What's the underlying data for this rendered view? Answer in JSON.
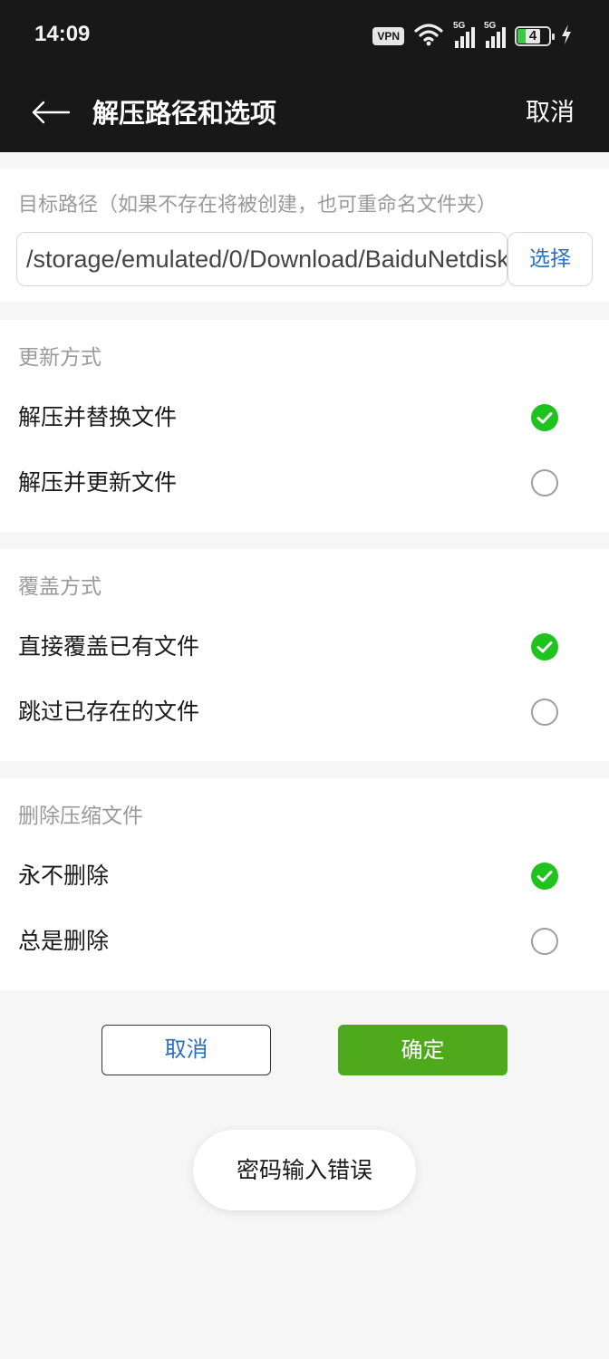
{
  "status_bar": {
    "time": "14:09",
    "vpn": "VPN",
    "network1": "5G",
    "network2": "5G",
    "battery_level": "4"
  },
  "header": {
    "title": "解压路径和选项",
    "cancel_label": "取消"
  },
  "path": {
    "label": "目标路径（如果不存在将被创建，也可重命名文件夹）",
    "value": "/storage/emulated/0/Download/BaiduNetdisk",
    "choose_label": "选择"
  },
  "update_mode": {
    "title": "更新方式",
    "options": [
      {
        "label": "解压并替换文件",
        "selected": true
      },
      {
        "label": "解压并更新文件",
        "selected": false
      }
    ]
  },
  "cover_mode": {
    "title": "覆盖方式",
    "options": [
      {
        "label": "直接覆盖已有文件",
        "selected": true
      },
      {
        "label": "跳过已存在的文件",
        "selected": false
      }
    ]
  },
  "delete_mode": {
    "title": "删除压缩文件",
    "options": [
      {
        "label": "永不删除",
        "selected": true
      },
      {
        "label": "总是删除",
        "selected": false
      }
    ]
  },
  "buttons": {
    "cancel_label": "取消",
    "ok_label": "确定"
  },
  "toast": {
    "message": "密码输入错误"
  },
  "colors": {
    "accent_green": "#4ea91c",
    "radio_checked": "#1ec31e",
    "link_blue": "#2b6fc4",
    "header_bg": "#181818"
  }
}
